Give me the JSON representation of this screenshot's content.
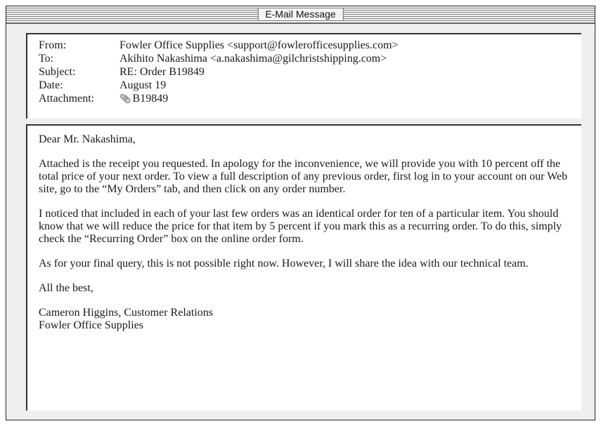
{
  "window": {
    "title": "E-Mail Message"
  },
  "header": {
    "from_label": "From:",
    "from_value": "Fowler Office Supplies <support@fowlerofficesupplies.com>",
    "to_label": "To:",
    "to_value": "Akihito Nakashima <a.nakashima@gilchristshipping.com>",
    "subject_label": "Subject:",
    "subject_value": "RE: Order B19849",
    "date_label": "Date:",
    "date_value": "August 19",
    "attachment_label": "Attachment:",
    "attachment_icon": "paperclip-icon",
    "attachment_value": "B19849"
  },
  "body": {
    "greeting": "Dear Mr. Nakashima,",
    "paragraph1": "Attached is the receipt you requested. In apology for the inconvenience, we will provide you with 10 percent off the total price of your next order. To view a full description of any previous order, first log in to your account on our Web site, go to the “My Orders” tab, and then click on any order number.",
    "paragraph2": "I noticed that included in each of your last few orders was an identical order for ten of a particular item. You should know that we will reduce the price for that item by 5 percent if you mark this as a recurring order. To do this, simply check the “Recurring Order” box on the online order form.",
    "paragraph3": "As for your final query, this is not possible right now. However, I will share the idea with our technical team.",
    "closing": "All the best,",
    "signature_name": "Cameron Higgins, Customer Relations",
    "signature_company": "Fowler Office Supplies"
  }
}
